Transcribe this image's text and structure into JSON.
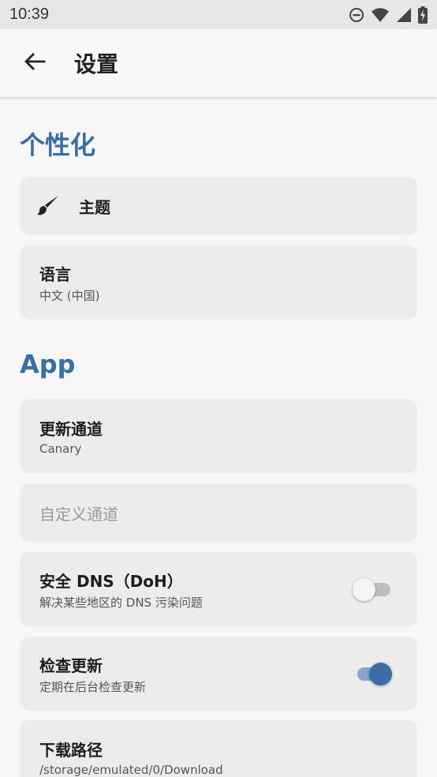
{
  "status_bar": {
    "time": "10:39",
    "icons": [
      "do-not-disturb-icon",
      "wifi-icon",
      "signal-icon",
      "battery-charging-icon"
    ]
  },
  "app_bar": {
    "back_icon": "arrow-back-icon",
    "title": "设置"
  },
  "sections": {
    "personalization": {
      "title": "个性化",
      "theme": {
        "icon": "brush-icon",
        "label": "主题"
      },
      "language": {
        "label": "语言",
        "value": "中文 (中国)"
      }
    },
    "app": {
      "title": "App",
      "update_channel": {
        "label": "更新通道",
        "value": "Canary"
      },
      "custom_channel": {
        "label": "自定义通道"
      },
      "secure_dns": {
        "label": "安全 DNS（DoH）",
        "description": "解决某些地区的 DNS 污染问题",
        "enabled": false
      },
      "check_updates": {
        "label": "检查更新",
        "description": "定期在后台检查更新",
        "enabled": true
      },
      "download_path": {
        "label": "下载路径",
        "value": "/storage/emulated/0/Download"
      }
    }
  },
  "colors": {
    "accent": "#3a6ea5",
    "card_background": "#ececec",
    "page_background": "#f7f7f7",
    "status_bar": "#e6e6e6"
  }
}
